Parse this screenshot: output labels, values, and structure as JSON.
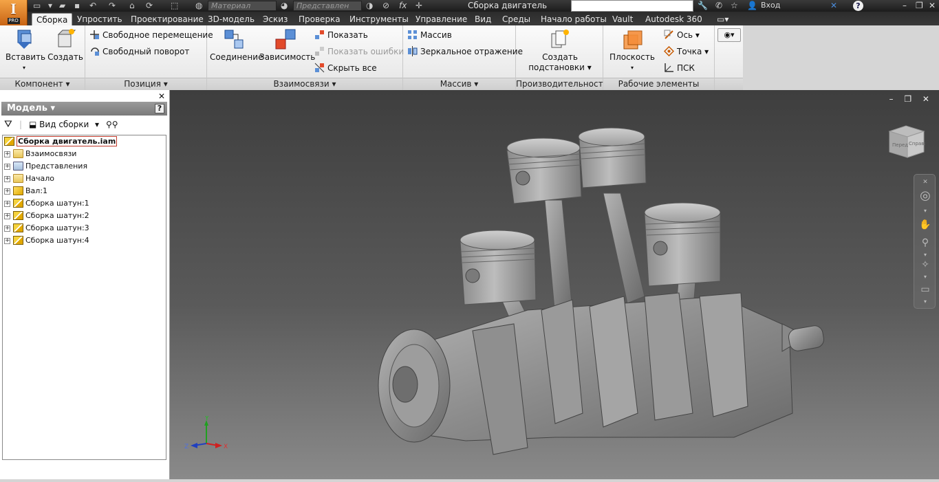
{
  "app": {
    "logo_glyph": "I",
    "logo_badge": "PRO"
  },
  "titlebar": {
    "document_title": "Сборка двигатель",
    "material_field": "Материал",
    "appearance_field": "Представлен",
    "fx_label": "fx",
    "signin_label": "Вход",
    "help_glyph": "?",
    "window_buttons": [
      "–",
      "❐",
      "✕"
    ]
  },
  "tabs": [
    "Сборка",
    "Упростить",
    "Проектирование",
    "3D-модель",
    "Эскиз",
    "Проверка",
    "Инструменты",
    "Управление",
    "Вид",
    "Среды",
    "Начало работы",
    "Vault",
    "Autodesk 360"
  ],
  "active_tab": "Сборка",
  "ribbon": {
    "component": {
      "title": "Компонент ▾",
      "insert": "Вставить",
      "create": "Создать"
    },
    "position": {
      "title": "Позиция ▾",
      "free_move": "Свободное перемещение",
      "free_rotate": "Свободный поворот"
    },
    "relations": {
      "title": "Взаимосвязи ▾",
      "joint": "Соединение",
      "constraint": "Зависимость",
      "show": "Показать",
      "show_errors": "Показать ошибки",
      "hide_all": "Скрыть все"
    },
    "pattern": {
      "title": "Массив ▾",
      "pattern": "Массив",
      "mirror": "Зеркальное отражение"
    },
    "productivity": {
      "title": "Производительность",
      "create_sub_1": "Создать",
      "create_sub_2": "подстановки ▾"
    },
    "work_features": {
      "title": "Рабочие элементы",
      "plane": "Плоскость",
      "axis": "Ось ▾",
      "point": "Точка ▾",
      "ucs": "ПСК"
    }
  },
  "browser": {
    "close_glyph": "✕",
    "header": "Модель ▾",
    "help_glyph": "?",
    "view_label": "Вид сборки",
    "tree": [
      {
        "label": "Сборка двигатель.iam",
        "icon": "assembly-icon",
        "root": true
      },
      {
        "label": "Взаимосвязи",
        "icon": "folder-icon"
      },
      {
        "label": "Представления",
        "icon": "representations-icon"
      },
      {
        "label": "Начало",
        "icon": "folder-icon"
      },
      {
        "label": "Вал:1",
        "icon": "part-icon"
      },
      {
        "label": "Сборка шатун:1",
        "icon": "assembly-icon"
      },
      {
        "label": "Сборка шатун:2",
        "icon": "assembly-icon"
      },
      {
        "label": "Сборка шатун:3",
        "icon": "assembly-icon"
      },
      {
        "label": "Сборка шатун:4",
        "icon": "assembly-icon"
      }
    ]
  },
  "viewport": {
    "window_controls": "– ❐ ✕",
    "viewcube_labels": [
      "Перед",
      "Справа"
    ],
    "triad": {
      "x": "X",
      "y": "Y",
      "z": "Z"
    },
    "colors": {
      "x_axis": "#d02020",
      "y_axis": "#20a020",
      "z_axis": "#2040c0"
    }
  }
}
